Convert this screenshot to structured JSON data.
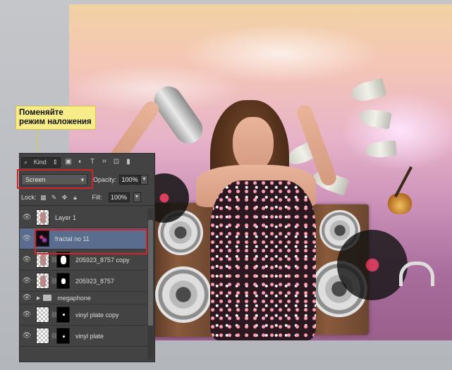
{
  "annotation": {
    "line1": "Поменяйте",
    "line2": "режим наложения"
  },
  "panel": {
    "kind_label": "Kind",
    "toolbar_icons": [
      "image-filter-icon",
      "adjustment-filter-icon",
      "type-filter-icon",
      "shape-filter-icon",
      "smart-object-filter-icon",
      "filter-toggle-icon"
    ],
    "blend_mode": "Screen",
    "opacity_label": "Opacity:",
    "opacity_value": "100%",
    "lock_label": "Lock:",
    "fill_label": "Fill:",
    "fill_value": "100%",
    "layers": [
      {
        "name": "Layer 1",
        "selected": false,
        "mask": false
      },
      {
        "name": "fractal no 11",
        "selected": true,
        "mask": false
      },
      {
        "name": "205923_8757 copy",
        "selected": false,
        "mask": true
      },
      {
        "name": "205923_8757",
        "selected": false,
        "mask": true
      },
      {
        "name": "megaphone",
        "group": true
      },
      {
        "name": "vinyl plate copy",
        "selected": false,
        "mask": true
      },
      {
        "name": "vinyl plate",
        "selected": false,
        "mask": true
      }
    ]
  },
  "colors": {
    "highlight": "#d2232a",
    "selected_layer": "#5a6d8f",
    "callout_bg": "#f7ec8a"
  }
}
